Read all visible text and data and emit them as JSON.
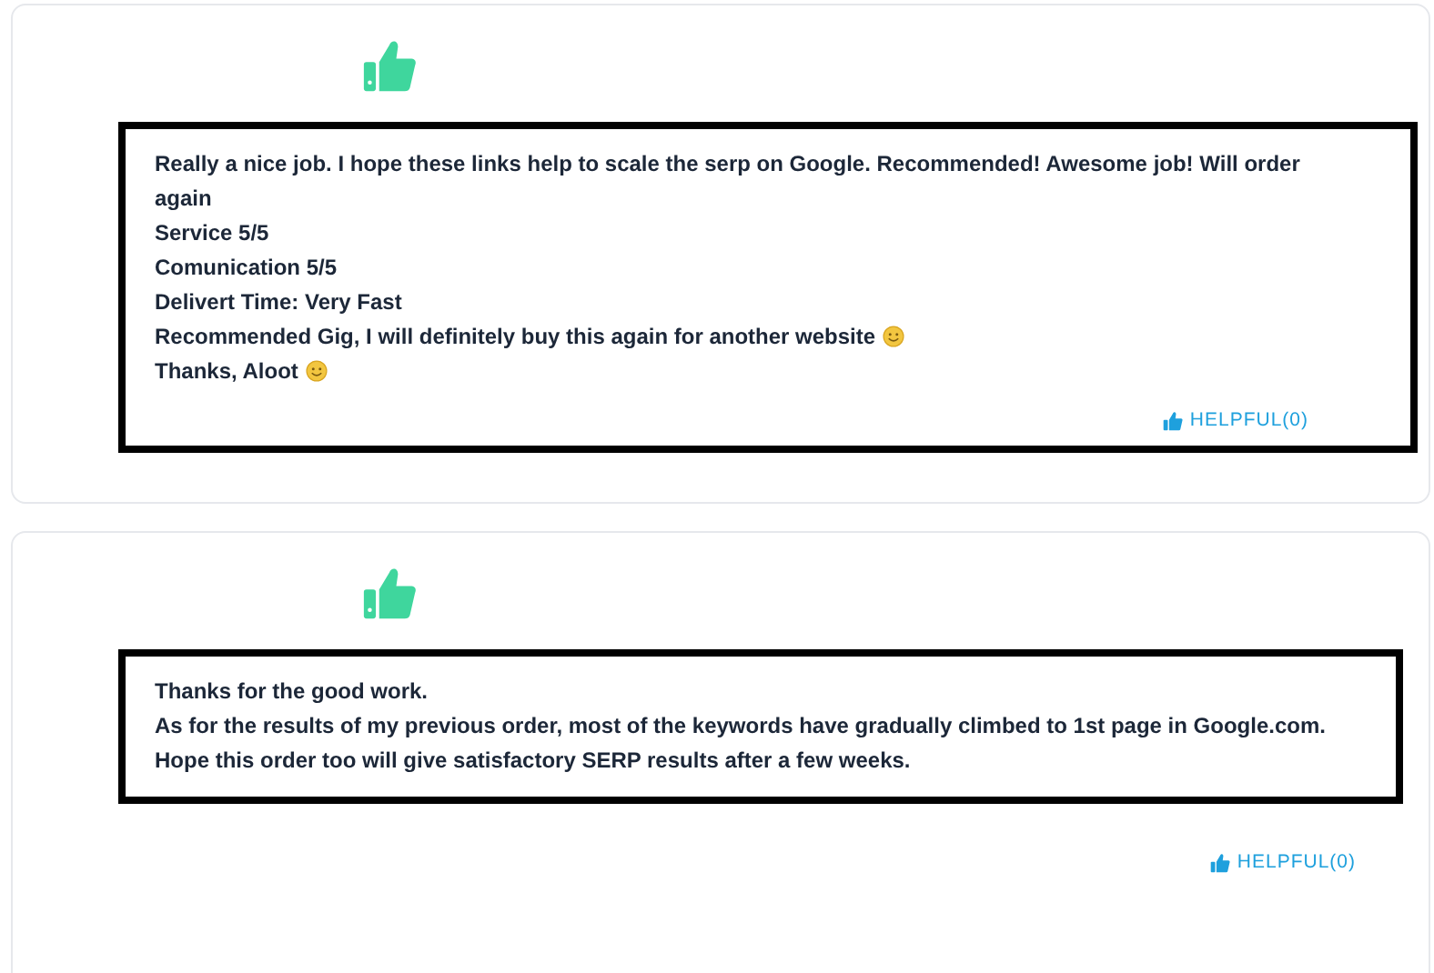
{
  "reviews": [
    {
      "box": {
        "lines": [
          {
            "text": "Really a nice job. I hope these links help to scale the serp on Google. Recommended! Awesome job! Will order again",
            "emoji": false
          },
          {
            "text": "Service 5/5",
            "emoji": false
          },
          {
            "text": "Comunication 5/5",
            "emoji": false
          },
          {
            "text": "Delivert Time: Very Fast",
            "emoji": false
          },
          {
            "text": "Recommended Gig, I will definitely buy this again for another website",
            "emoji": true
          },
          {
            "text": "Thanks, Aloot",
            "emoji": true
          }
        ],
        "helpful": "HELPFUL(0)"
      }
    },
    {
      "box": {
        "lines": [
          {
            "text": "Thanks for the good work.",
            "emoji": false
          },
          {
            "text": "As for the results of my previous order, most of the keywords have gradually climbed to 1st page in Google.com.",
            "emoji": false
          },
          {
            "text": "Hope this order too will give satisfactory SERP results after a few weeks.",
            "emoji": false
          }
        ]
      },
      "helpful": "HELPFUL(0)"
    }
  ]
}
